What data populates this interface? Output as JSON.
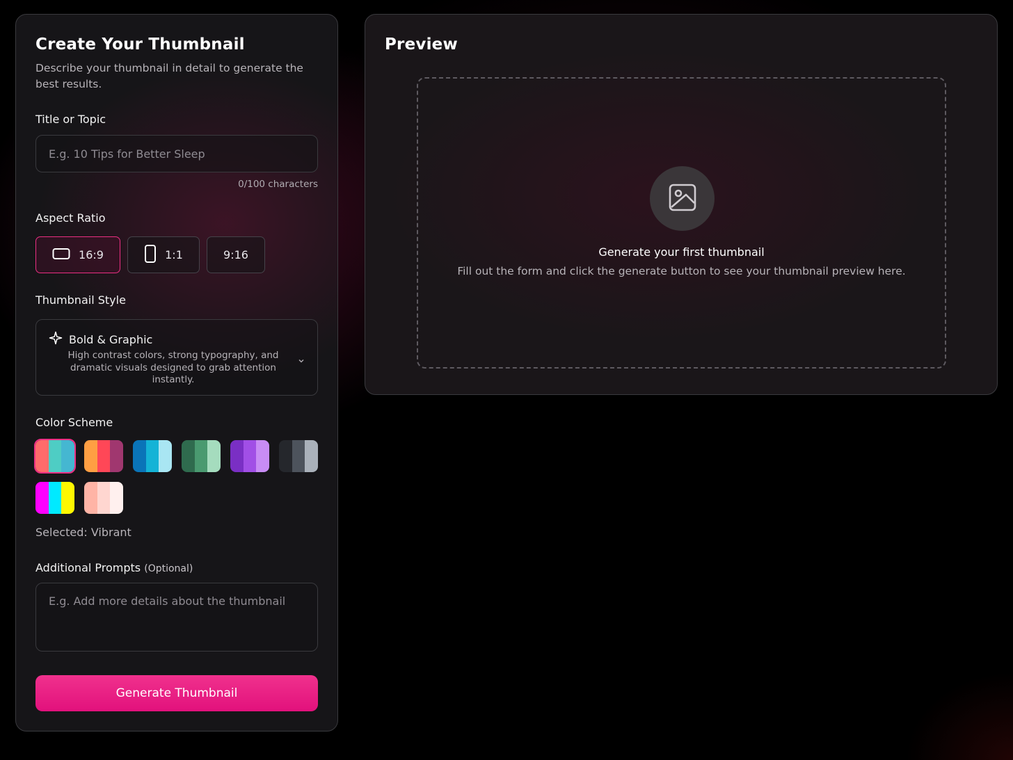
{
  "form": {
    "title": "Create Your Thumbnail",
    "description_line1": "Describe your thumbnail in detail to generate the",
    "description_line2": "best results.",
    "title_label": "Title or Topic",
    "title_placeholder": "E.g. 10 Tips for Better Sleep",
    "title_value": "",
    "char_count": "0/100 characters",
    "aspect_label": "Aspect Ratio",
    "aspect_options": [
      {
        "label": "16:9",
        "icon": "landscape-rect-icon",
        "selected": true
      },
      {
        "label": "1:1",
        "icon": "portrait-rect-icon",
        "selected": false
      },
      {
        "label": "9:16",
        "icon": "",
        "selected": false
      }
    ],
    "style_label": "Thumbnail Style",
    "style_selected": {
      "name": "Bold & Graphic",
      "icon": "sparkle-icon",
      "desc_line1": "High contrast colors, strong typography, and",
      "desc_line2": "dramatic visuals designed to grab attention",
      "desc_line3": "instantly."
    },
    "color_label": "Color Scheme",
    "color_schemes": [
      {
        "colors": [
          "#ff6b6b",
          "#4ecdc4",
          "#45b7d1"
        ],
        "selected": true
      },
      {
        "colors": [
          "#ff9f43",
          "#ff4757",
          "#a0376f"
        ],
        "selected": false
      },
      {
        "colors": [
          "#0a74b8",
          "#14b3d6",
          "#a9e6f3"
        ],
        "selected": false
      },
      {
        "colors": [
          "#2f6b4e",
          "#4a9a70",
          "#a5dcbe"
        ],
        "selected": false
      },
      {
        "colors": [
          "#7a2fc4",
          "#a14fe6",
          "#c88cf5"
        ],
        "selected": false
      },
      {
        "colors": [
          "#25272c",
          "#4d535c",
          "#aab1ba"
        ],
        "selected": false
      },
      {
        "colors": [
          "#ff00ff",
          "#00eaff",
          "#fff700"
        ],
        "selected": false
      },
      {
        "colors": [
          "#ffb4a6",
          "#ffd6d0",
          "#fff0ee"
        ],
        "selected": false
      }
    ],
    "selected_scheme_text": "Selected: Vibrant",
    "prompts_label": "Additional Prompts",
    "prompts_optional": "(Optional)",
    "prompts_placeholder": "E.g. Add more details about the thumbnail",
    "prompts_value": "",
    "generate_label": "Generate Thumbnail"
  },
  "preview": {
    "title": "Preview",
    "placeholder_icon": "image-icon",
    "empty_title": "Generate your first thumbnail",
    "empty_desc": "Fill out the form and click the generate button to see your thumbnail preview here."
  }
}
